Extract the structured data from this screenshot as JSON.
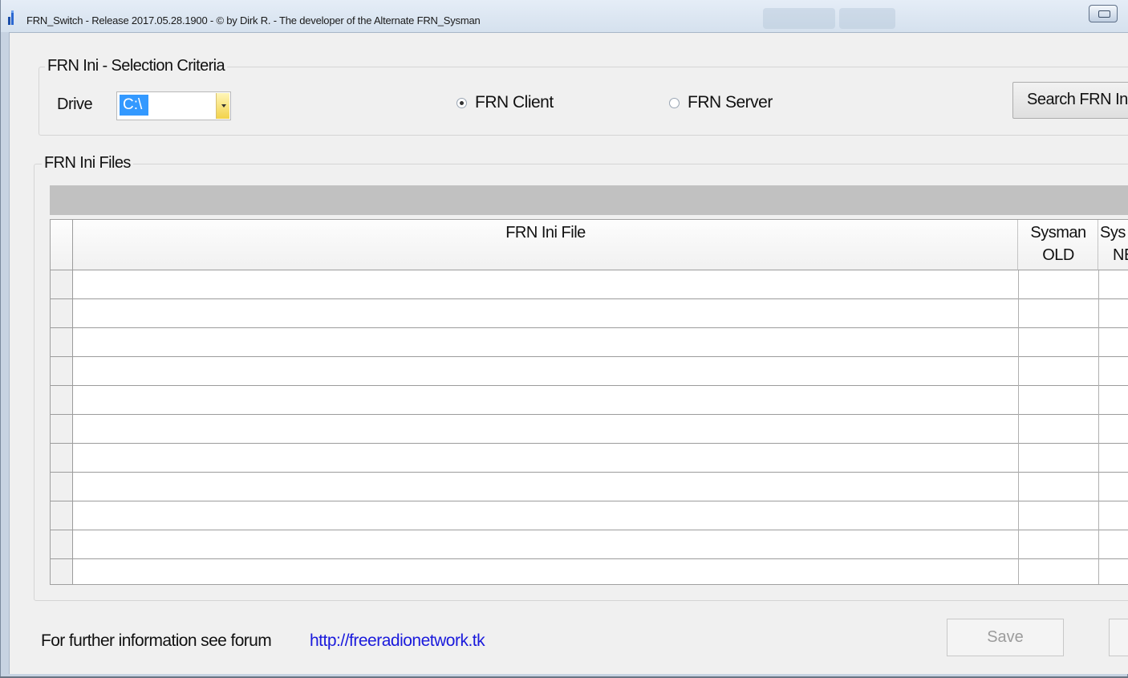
{
  "window": {
    "title": "FRN_Switch - Release 2017.05.28.1900 - © by Dirk R. - The developer of the Alternate FRN_Sysman"
  },
  "selection_group": {
    "label": "FRN Ini - Selection Criteria",
    "drive_label": "Drive",
    "drive_value": "C:\\",
    "radio_client": {
      "label": "FRN Client",
      "selected": true
    },
    "radio_server": {
      "label": "FRN Server",
      "selected": false
    },
    "search_button": "Search FRN Ini"
  },
  "files_group": {
    "label": "FRN Ini Files",
    "columns": [
      "FRN Ini File",
      "Sysman OLD",
      "Sysman NEW"
    ],
    "column_lines": [
      [
        "FRN Ini File"
      ],
      [
        "Sysman",
        "OLD"
      ],
      [
        "Sys",
        "NE"
      ]
    ],
    "rows": 11
  },
  "footer": {
    "info_text": "For further information see forum",
    "link": "http://freeradionetwork.tk",
    "save_button": "Save"
  },
  "colors": {
    "selection": "#3399ff",
    "link": "#1a1adc",
    "grid_caption": "#c1c1c1"
  }
}
